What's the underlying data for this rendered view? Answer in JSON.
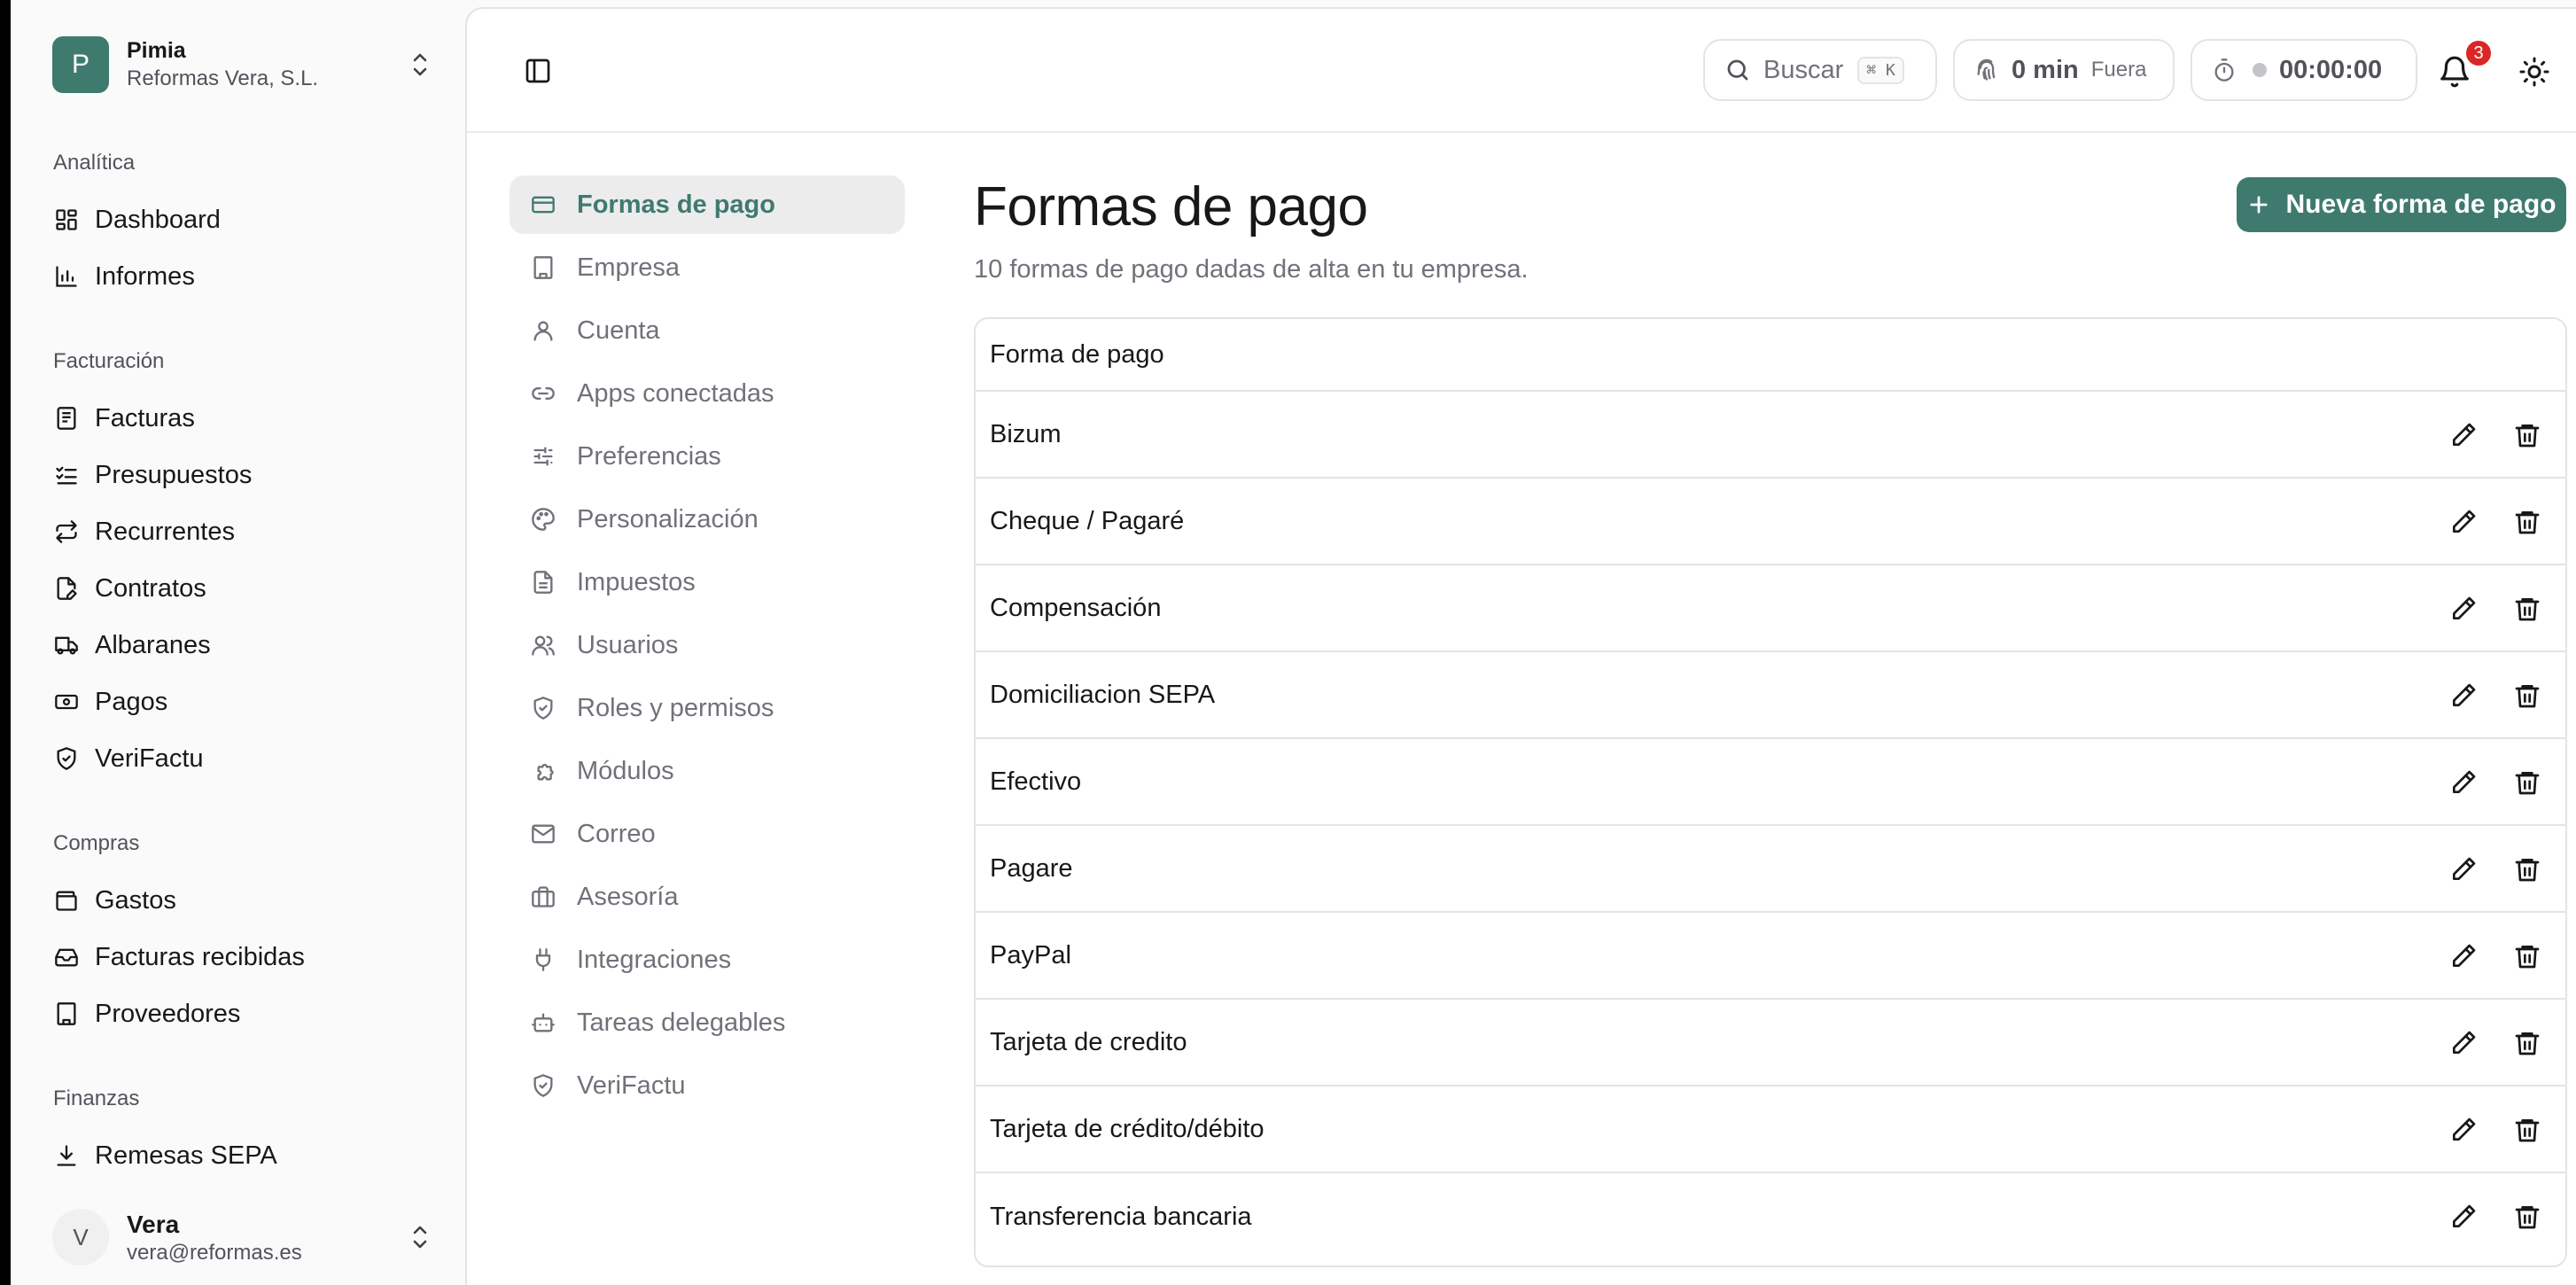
{
  "org": {
    "initial": "P",
    "name": "Pimia",
    "company": "Reformas Vera, S.L."
  },
  "sidebar": {
    "sections": [
      {
        "label": "Analítica",
        "items": [
          {
            "label": "Dashboard",
            "icon": "dashboard-icon"
          },
          {
            "label": "Informes",
            "icon": "bar-chart-icon"
          }
        ]
      },
      {
        "label": "Facturación",
        "items": [
          {
            "label": "Facturas",
            "icon": "receipt-icon"
          },
          {
            "label": "Presupuestos",
            "icon": "list-check-icon"
          },
          {
            "label": "Recurrentes",
            "icon": "repeat-icon"
          },
          {
            "label": "Contratos",
            "icon": "file-pen-icon"
          },
          {
            "label": "Albaranes",
            "icon": "truck-icon"
          },
          {
            "label": "Pagos",
            "icon": "banknote-icon"
          },
          {
            "label": "VeriFactu",
            "icon": "shield-check-icon"
          }
        ]
      },
      {
        "label": "Compras",
        "items": [
          {
            "label": "Gastos",
            "icon": "wallet-icon"
          },
          {
            "label": "Facturas recibidas",
            "icon": "inbox-icon"
          },
          {
            "label": "Proveedores",
            "icon": "building-icon"
          }
        ]
      },
      {
        "label": "Finanzas",
        "items": [
          {
            "label": "Remesas SEPA",
            "icon": "download-icon"
          }
        ]
      }
    ]
  },
  "user": {
    "initial": "V",
    "name": "Vera",
    "email": "vera@reformas.es"
  },
  "topbar": {
    "search_placeholder": "Buscar",
    "search_shortcut": "⌘ K",
    "clock_value": "0 min",
    "clock_status": "Fuera",
    "timer_value": "00:00:00",
    "notifications_count": "3"
  },
  "settings_nav": {
    "active": "Formas de pago",
    "items": [
      {
        "label": "Formas de pago",
        "icon": "credit-card-icon"
      },
      {
        "label": "Empresa",
        "icon": "building-icon"
      },
      {
        "label": "Cuenta",
        "icon": "user-icon"
      },
      {
        "label": "Apps conectadas",
        "icon": "link-icon"
      },
      {
        "label": "Preferencias",
        "icon": "sliders-icon"
      },
      {
        "label": "Personalización",
        "icon": "palette-icon"
      },
      {
        "label": "Impuestos",
        "icon": "file-text-icon"
      },
      {
        "label": "Usuarios",
        "icon": "users-icon"
      },
      {
        "label": "Roles y permisos",
        "icon": "shield-check-icon"
      },
      {
        "label": "Módulos",
        "icon": "puzzle-icon"
      },
      {
        "label": "Correo",
        "icon": "mail-icon"
      },
      {
        "label": "Asesoría",
        "icon": "briefcase-icon"
      },
      {
        "label": "Integraciones",
        "icon": "plug-icon"
      },
      {
        "label": "Tareas delegables",
        "icon": "bot-icon"
      },
      {
        "label": "VeriFactu",
        "icon": "shield-check-icon"
      }
    ]
  },
  "content": {
    "title": "Formas de pago",
    "subtitle": "10 formas de pago dadas de alta en tu empresa.",
    "new_button": "Nueva forma de pago",
    "table": {
      "header": "Forma de pago",
      "rows": [
        "Bizum",
        "Cheque / Pagaré",
        "Compensación",
        "Domiciliacion SEPA",
        "Efectivo",
        "Pagare",
        "PayPal",
        "Tarjeta de credito",
        "Tarjeta de crédito/débito",
        "Transferencia bancaria"
      ]
    }
  },
  "colors": {
    "accent": "#3f7a6f",
    "badge": "#dc2626",
    "muted": "#71717a"
  }
}
